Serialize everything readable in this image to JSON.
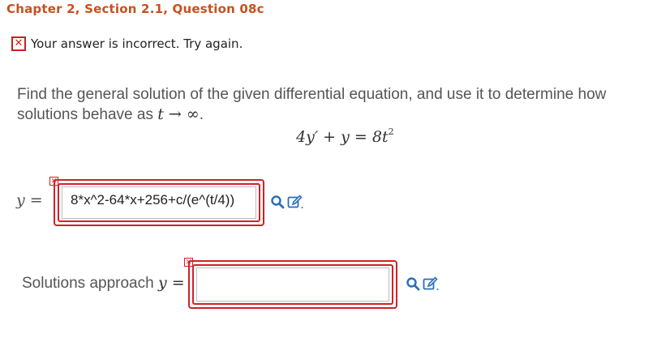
{
  "header": {
    "title": "Chapter 2, Section 2.1, Question 08c"
  },
  "feedback": {
    "icon": "incorrect-x-icon",
    "text": "Your answer is incorrect.  Try again."
  },
  "problem": {
    "text_before": "Find the general solution of the given differential equation, and use it to determine how solutions behave as ",
    "limit_expr": "t → ∞",
    "text_after": ".",
    "equation": "4y′ + y = 8t",
    "equation_exponent": "2"
  },
  "answer1": {
    "label": "y =",
    "value": "8*x^2-64*x+256+c/(e^(t/4))",
    "status": "incorrect"
  },
  "answer2": {
    "label_text": "Solutions approach ",
    "label_math": "y =",
    "value": "",
    "status": "incorrect"
  },
  "colors": {
    "heading": "#c8501e",
    "error": "#d32027",
    "icon": "#2a6ebb"
  }
}
